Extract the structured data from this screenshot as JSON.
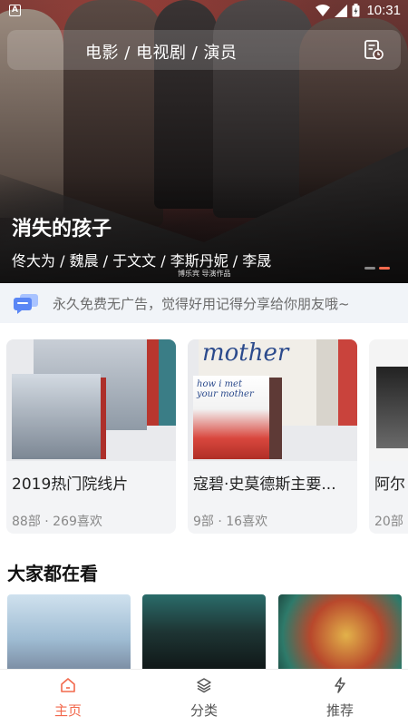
{
  "status_bar": {
    "time": "10:31",
    "colors": {
      "text": "#ffffff"
    }
  },
  "search": {
    "placeholder": "电影 / 电视剧 / 演员",
    "icon": "document-history-icon"
  },
  "banner": {
    "title": "消失的孩子",
    "cast": "佟大为 / 魏晨 / 于文文 / 李斯丹妮 / 李晟",
    "brand": "博乐宾 导演作品"
  },
  "notice": {
    "icon": "chat-bubbles-icon",
    "text": "永久免费无广告，觉得好用记得分享给你朋友哦~"
  },
  "playlists": [
    {
      "title": "2019热门院线片",
      "meta": "88部 · 269喜欢"
    },
    {
      "title": "寇碧·史莫德斯主要...",
      "meta": "9部 · 16喜欢",
      "cover_text": "mother",
      "cover_text_2": "how i met your mother"
    },
    {
      "title": "阿尔",
      "meta": "20部"
    }
  ],
  "section": {
    "title": "大家都在看"
  },
  "nav": {
    "items": [
      {
        "label": "主页",
        "icon": "home-icon",
        "active": true
      },
      {
        "label": "分类",
        "icon": "layers-icon",
        "active": false
      },
      {
        "label": "推荐",
        "icon": "lightning-icon",
        "active": false
      }
    ]
  },
  "colors": {
    "accent": "#f2684c",
    "notice_bg": "#f1f4f8",
    "card_bg": "#f3f4f6"
  }
}
